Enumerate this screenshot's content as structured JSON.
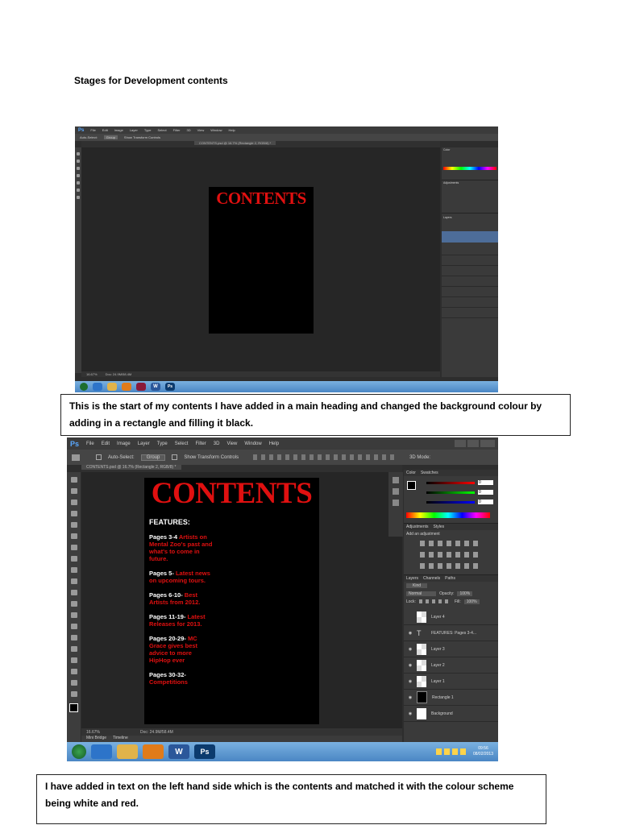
{
  "doc": {
    "heading": "Stages for Development contents",
    "caption1": "This is the start of my contents I have added in a main heading and changed the background colour by adding in a rectangle and filling it black.",
    "caption2": "I have added in text on the left hand side which is the contents and matched it with the colour scheme being white and red."
  },
  "ps_menu": {
    "logo": "Ps",
    "items": [
      "File",
      "Edit",
      "Image",
      "Layer",
      "Type",
      "Select",
      "Filter",
      "3D",
      "View",
      "Window",
      "Help"
    ]
  },
  "ps_options": {
    "auto_select": "Auto-Select:",
    "group_value": "Group",
    "show_transform": "Show Transform Controls",
    "mode_3d": "3D Mode:"
  },
  "doc_tab": "CONTENTS.psd @ 16.7% (Rectangle 2, RGB/8) *",
  "canvas_title": "CONTENTS",
  "features": {
    "heading": "FEATURES:",
    "entries": [
      {
        "pages": "Pages 3-4",
        "desc": "Artists on Mental Zoo's past and what's to come in future."
      },
      {
        "pages": "Pages 5-",
        "desc": "Latest news on upcoming tours."
      },
      {
        "pages": "Pages 6-10-",
        "desc": "Best Artists from 2012."
      },
      {
        "pages": "Pages 11-19-",
        "desc": "Latest Releases for 2013."
      },
      {
        "pages": "Pages 20-29-",
        "desc": "MC Grace gives best advice to more HipHop ever"
      },
      {
        "pages": "Pages 30-32-",
        "desc": "Competitions"
      }
    ]
  },
  "status": {
    "zoom": "16.67%",
    "doc_size": "Doc: 24.9M/58.4M"
  },
  "bottom_tabs": [
    "Mini Bridge",
    "Timeline"
  ],
  "panels": {
    "color_tabs": [
      "Color",
      "Swatches"
    ],
    "color_values": [
      "0",
      "0",
      "0"
    ],
    "adjust_tabs": [
      "Adjustments",
      "Styles"
    ],
    "add_adjustment": "Add an adjustment",
    "layer_tabs": [
      "Layers",
      "Channels",
      "Paths"
    ],
    "kind": "Kind",
    "blend": "Normal",
    "opacity_label": "Opacity:",
    "opacity": "100%",
    "lock_label": "Lock:",
    "fill_label": "Fill:",
    "fill": "100%",
    "layers": [
      "Layer 4",
      "FEATURES: Pages 3-4...",
      "Layer 3",
      "Layer 2",
      "Layer 1",
      "Rectangle 1",
      "Background"
    ]
  },
  "taskbar": {
    "time": "09:56",
    "date": "08/02/2013",
    "word": "W",
    "ps": "Ps"
  },
  "colors": {
    "accent_red": "#e01010",
    "ps_dark": "#2d2d2d",
    "taskbar_blue": "#4a86c4"
  }
}
